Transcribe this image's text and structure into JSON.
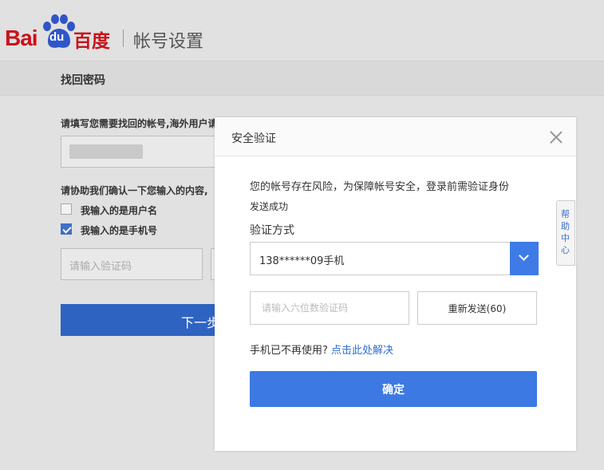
{
  "header": {
    "logo_bai": "Bai",
    "logo_du": "du",
    "logo_cn": "百度",
    "account_title": "帐号设置"
  },
  "subbar": {
    "title": "找回密码"
  },
  "background_form": {
    "account_label": "请填写您需要找回的帐号,海外用户请",
    "confirm_label": "请协助我们确认一下您输入的内容,",
    "option_username": "我输入的是用户名",
    "option_phone": "我输入的是手机号",
    "option_phone_checked": true,
    "captcha_placeholder": "请输入验证码",
    "next_label": "下一步"
  },
  "help_tab": {
    "label": "帮助中心"
  },
  "modal": {
    "title": "安全验证",
    "risk_message": "您的帐号存在风险，为保障帐号安全，登录前需验证身份",
    "sent_status": "发送成功",
    "method_label": "验证方式",
    "method_selected": "138******09手机",
    "code_placeholder": "请输入六位数验证码",
    "resend_label": "重新发送(60)",
    "phone_lost_text": "手机已不再使用?",
    "phone_lost_link": "点击此处解决",
    "confirm_label": "确定"
  },
  "colors": {
    "brand_red": "#c8121b",
    "accent_blue": "#3d79e2",
    "link_blue": "#2f6fd6"
  }
}
